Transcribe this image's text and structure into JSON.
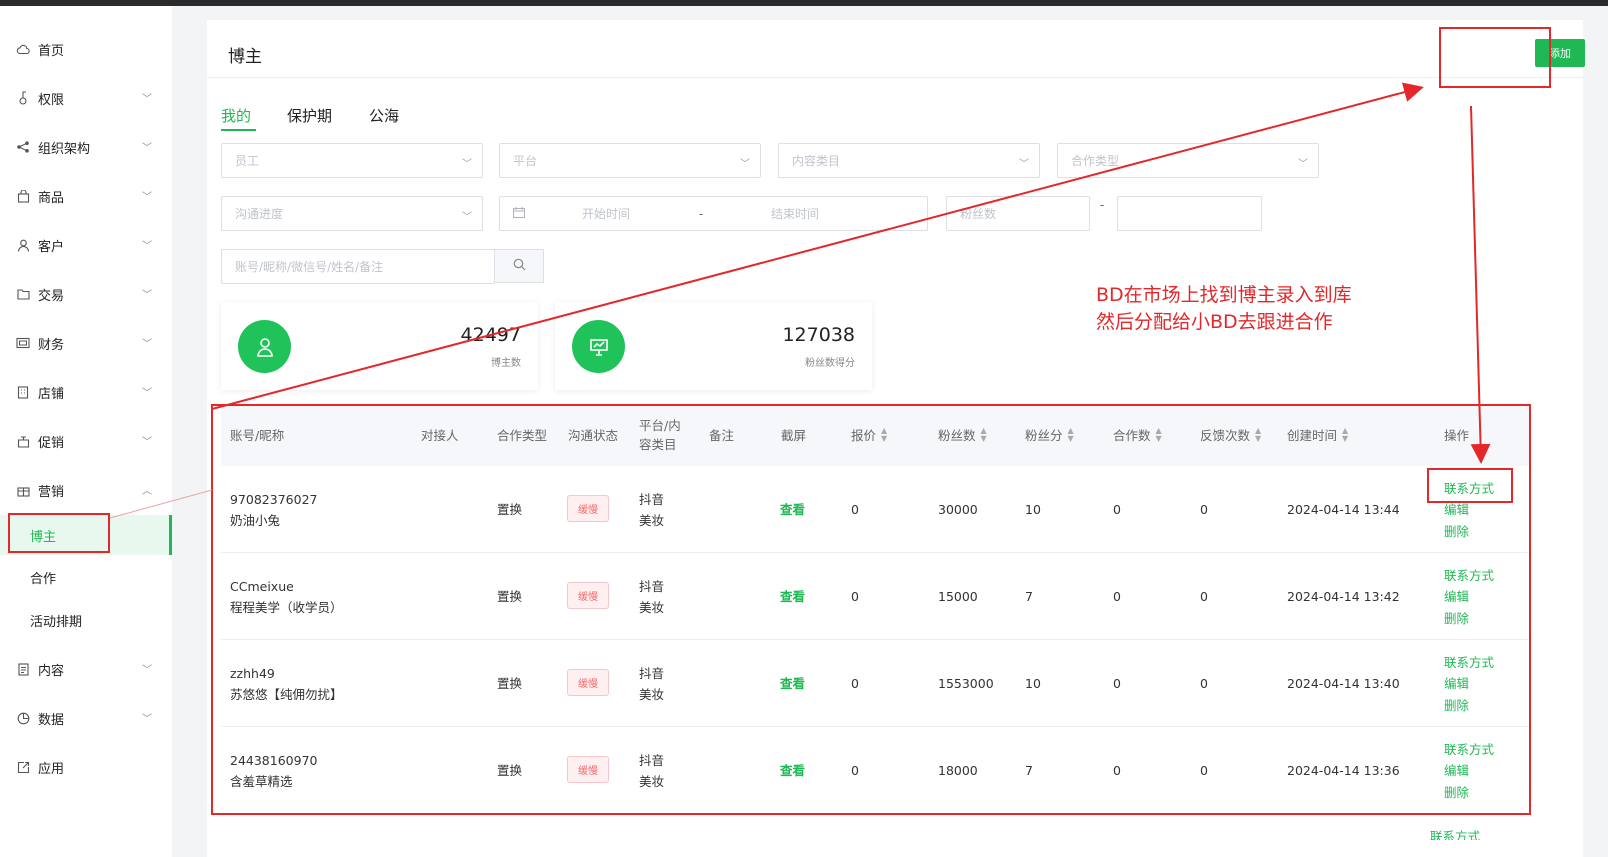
{
  "sidebar": {
    "items": [
      {
        "label": "首页",
        "icon": "cloud-icon"
      },
      {
        "label": "权限",
        "icon": "key-icon"
      },
      {
        "label": "组织架构",
        "icon": "share-icon"
      },
      {
        "label": "商品",
        "icon": "bag-icon"
      },
      {
        "label": "客户",
        "icon": "user-icon"
      },
      {
        "label": "交易",
        "icon": "folder-icon"
      },
      {
        "label": "财务",
        "icon": "wallet-icon"
      },
      {
        "label": "店铺",
        "icon": "building-icon"
      },
      {
        "label": "促销",
        "icon": "promo-icon"
      },
      {
        "label": "营销",
        "icon": "gift-icon"
      }
    ],
    "sub_items": [
      "博主",
      "合作",
      "活动排期"
    ],
    "bottom_items": [
      {
        "label": "内容",
        "icon": "document-icon"
      },
      {
        "label": "数据",
        "icon": "pie-chart-icon"
      },
      {
        "label": "应用",
        "icon": "external-link-icon"
      }
    ]
  },
  "header": {
    "title": "博主",
    "add_label": "添加"
  },
  "tabs": [
    "我的",
    "保护期",
    "公海"
  ],
  "filters": {
    "employee": "员工",
    "platform": "平台",
    "content_category": "内容类目",
    "coop_type": "合作类型",
    "comm_progress": "沟通进度",
    "start_time": "开始时间",
    "range_sep": "-",
    "end_time": "结束时间",
    "fans": "粉丝数",
    "fans_sep": "-",
    "search_placeholder": "账号/昵称/微信号/姓名/备注"
  },
  "stats": [
    {
      "value": "42497",
      "label": "博主数",
      "icon": "user-icon"
    },
    {
      "value": "127038",
      "label": "粉丝数得分",
      "icon": "presentation-chart-icon"
    }
  ],
  "table": {
    "columns": {
      "account": "账号/昵称",
      "contact": "对接人",
      "coop_type": "合作类型",
      "comm_status": "沟通状态",
      "platform_l1": "平台/内",
      "platform_l2": "容类目",
      "remark": "备注",
      "screenshot": "截屏",
      "quote": "报价",
      "fans": "粉丝数",
      "fan_score": "粉丝分",
      "coop_count": "合作数",
      "feedback": "反馈次数",
      "created": "创建时间",
      "ops": "操作"
    },
    "rows": [
      {
        "account": "97082376027",
        "nickname": "奶油小兔",
        "coop_type": "置换",
        "status": "缓慢",
        "platform": "抖音",
        "category": "美妆",
        "screenshot": "查看",
        "quote": "0",
        "fans": "30000",
        "fan_score": "10",
        "coop_count": "0",
        "feedback": "0",
        "created": "2024-04-14 13:44"
      },
      {
        "account": "CCmeixue",
        "nickname": "程程美学（收学员）",
        "coop_type": "置换",
        "status": "缓慢",
        "platform": "抖音",
        "category": "美妆",
        "screenshot": "查看",
        "quote": "0",
        "fans": "15000",
        "fan_score": "7",
        "coop_count": "0",
        "feedback": "0",
        "created": "2024-04-14 13:42"
      },
      {
        "account": "zzhh49",
        "nickname": "苏悠悠【纯佣勿扰】",
        "coop_type": "置换",
        "status": "缓慢",
        "platform": "抖音",
        "category": "美妆",
        "screenshot": "查看",
        "quote": "0",
        "fans": "1553000",
        "fan_score": "10",
        "coop_count": "0",
        "feedback": "0",
        "created": "2024-04-14 13:40"
      },
      {
        "account": "24438160970",
        "nickname": "含羞草精选",
        "coop_type": "置换",
        "status": "缓慢",
        "platform": "抖音",
        "category": "美妆",
        "screenshot": "查看",
        "quote": "0",
        "fans": "18000",
        "fan_score": "7",
        "coop_count": "0",
        "feedback": "0",
        "created": "2024-04-14 13:36"
      }
    ],
    "actions": [
      "联系方式",
      "编辑",
      "删除"
    ],
    "next_row_peek": "联系方式"
  },
  "annotation": {
    "line1": "BD在市场上找到博主录入到库",
    "line2": "然后分配给小BD去跟进合作"
  },
  "colors": {
    "accent": "#1fb855",
    "annotation": "#e3282b",
    "status_tag": "#f56c6c"
  }
}
